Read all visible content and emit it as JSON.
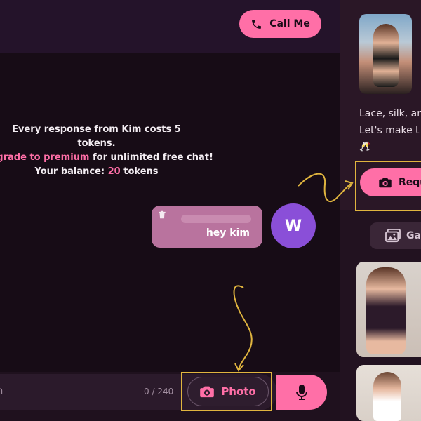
{
  "header": {
    "call_label": "Call Me"
  },
  "chat": {
    "info_line1": "Every response from Kim costs 5 tokens.",
    "info_upgrade": "pgrade to premium",
    "info_line2_rest": " for unlimited free chat!",
    "balance_prefix": "Your balance: ",
    "balance_value": "20",
    "balance_suffix": " tokens",
    "message_text": "hey kim",
    "user_avatar_letter": "W"
  },
  "input": {
    "placeholder": "n",
    "counter": "0 / 240",
    "photo_label": "Photo"
  },
  "profile": {
    "bio_line1": "Lace, silk, ar",
    "bio_line2": "Let's make t",
    "bio_emoji": "🥂",
    "request_label": "Requ",
    "gallery_label": "Ga"
  },
  "colors": {
    "accent": "#ff6fa7",
    "avatar": "#8a4fd8",
    "highlight": "#e0b53f",
    "background": "#1c0f1b"
  },
  "icons": [
    "phone-icon",
    "trash-icon",
    "camera-icon",
    "microphone-icon",
    "gallery-icon"
  ]
}
